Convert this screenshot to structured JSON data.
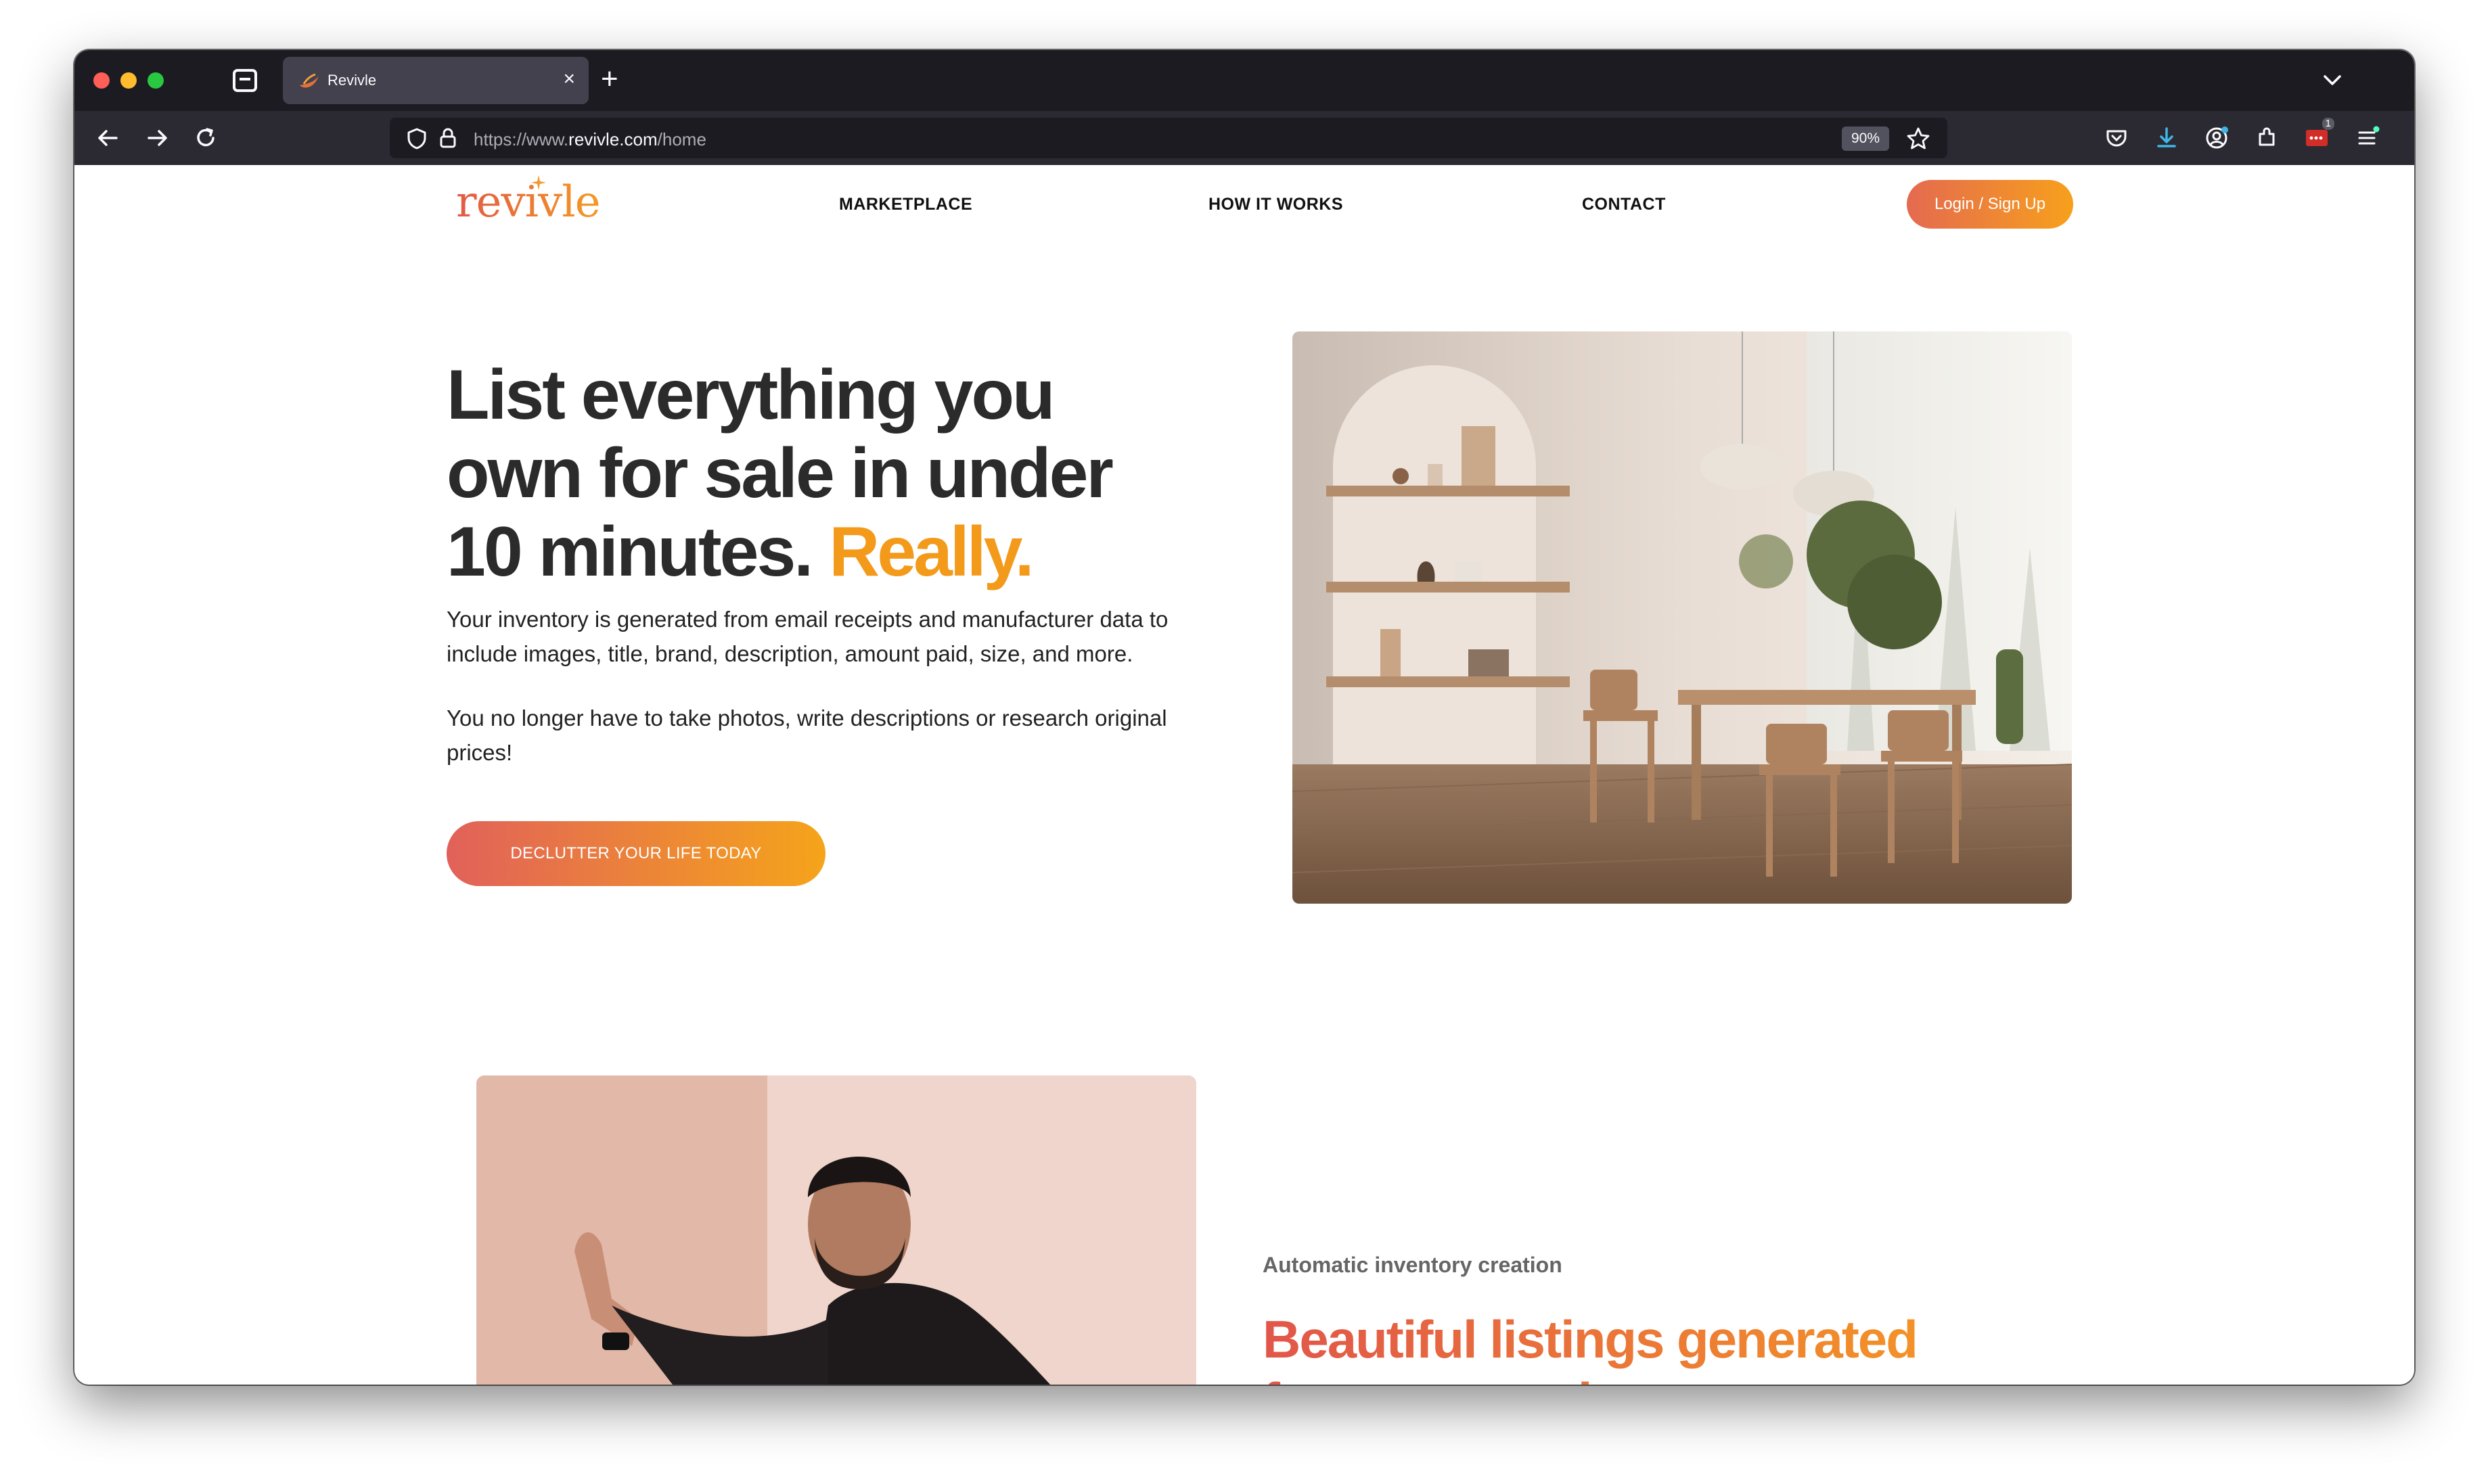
{
  "browser": {
    "tab_title": "Revivle",
    "tab_close": "×",
    "new_tab": "+",
    "url_prefix": "https://www.",
    "url_host": "revivle.com",
    "url_path": "/home",
    "zoom": "90%",
    "extension_badge": "1"
  },
  "site": {
    "logo": "revivle",
    "nav": {
      "marketplace": "MARKETPLACE",
      "how_it_works": "HOW IT WORKS",
      "contact": "CONTACT"
    },
    "login_label": "Login / Sign Up"
  },
  "hero": {
    "title_main": "List everything you own for sale in under 10 minutes.",
    "title_accent": "Really.",
    "paragraph_1": "Your inventory is generated from email receipts and manufacturer data to include images, title, brand, description, amount paid, size, and more.",
    "paragraph_2": "You no longer have to take photos, write descriptions or research original prices!",
    "cta_label": "DECLUTTER YOUR LIFE TODAY"
  },
  "feature": {
    "kicker": "Automatic inventory creation",
    "title": "Beautiful listings generated from your orders"
  },
  "colors": {
    "accent_orange": "#f39a1b",
    "accent_coral": "#e1615a",
    "browser_dark": "#1c1b22"
  },
  "icons": [
    "back-icon",
    "forward-icon",
    "reload-icon",
    "shield-icon",
    "lock-icon",
    "star-icon",
    "pocket-icon",
    "download-icon",
    "account-icon",
    "extensions-icon",
    "menu-icon",
    "chevron-down-icon"
  ]
}
